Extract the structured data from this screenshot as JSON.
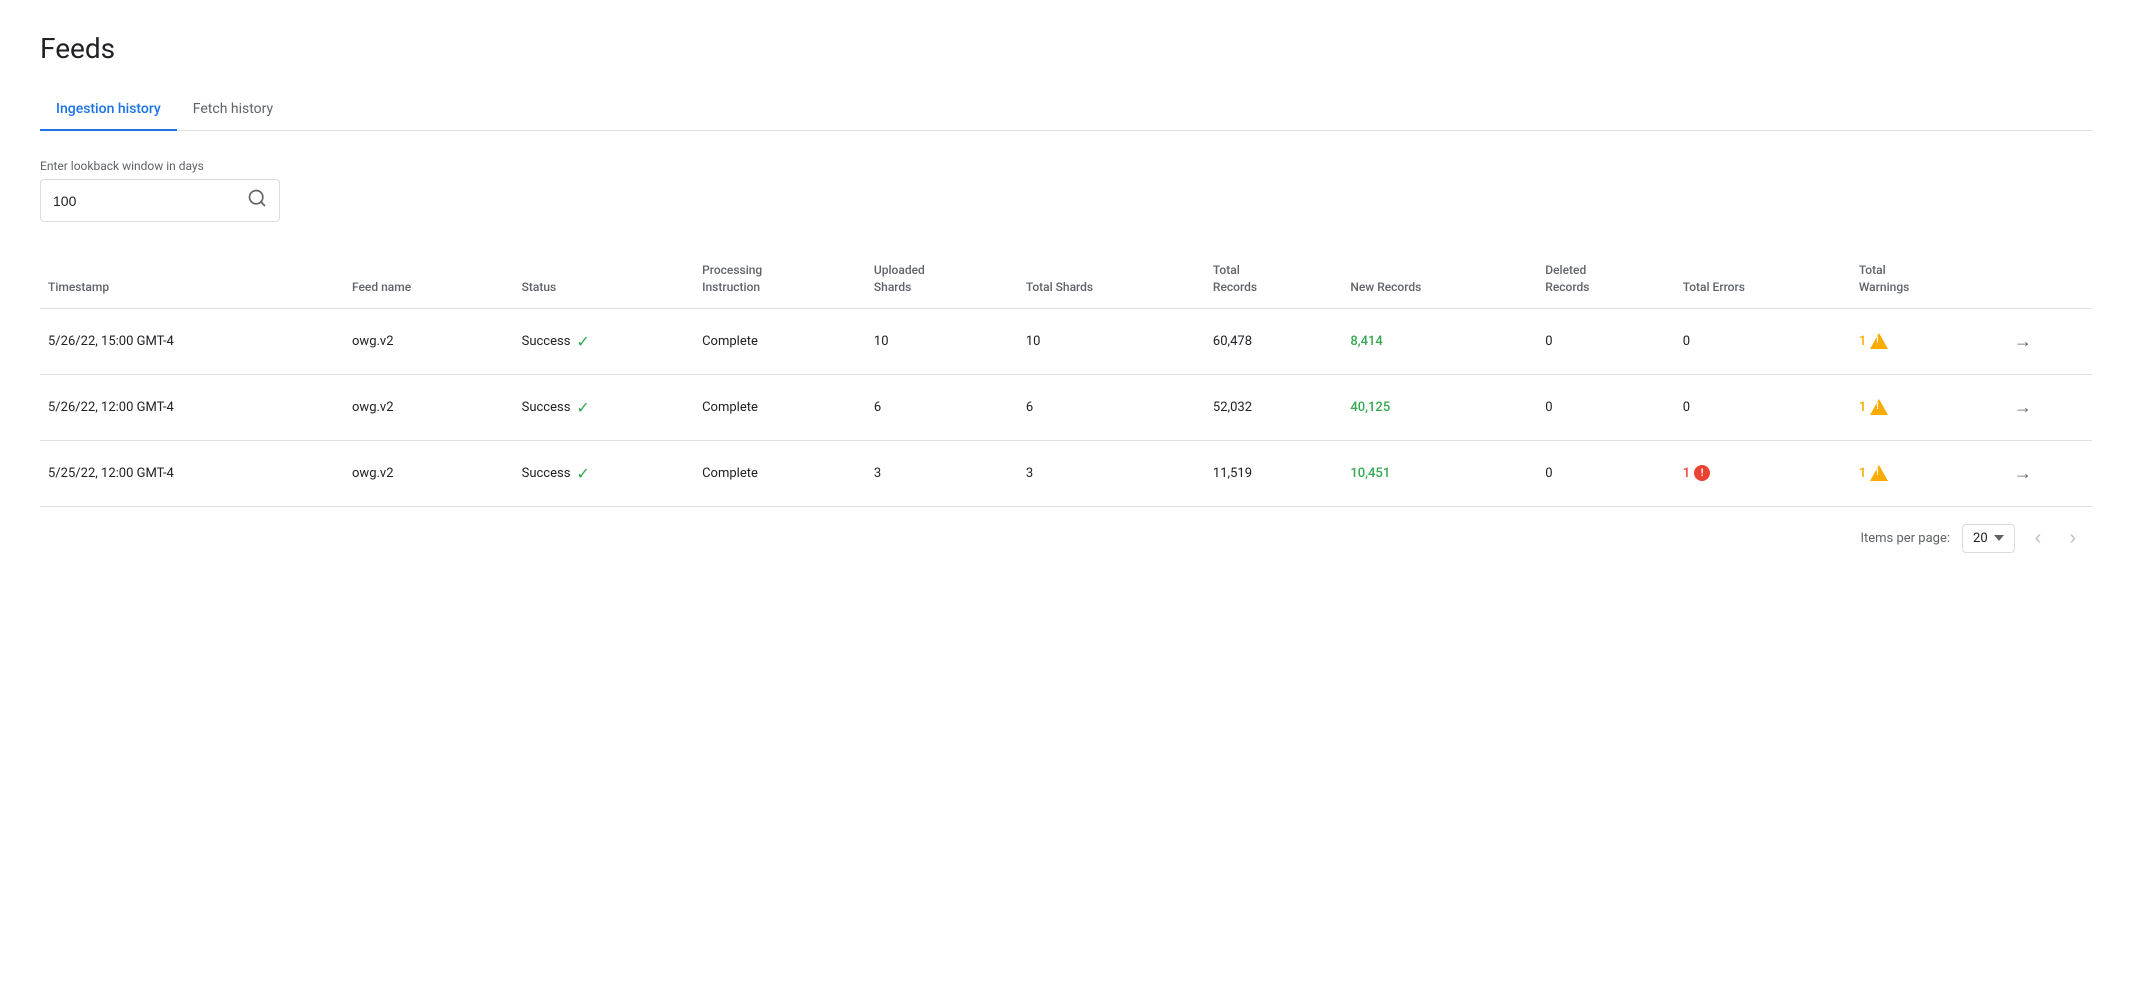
{
  "page": {
    "title": "Feeds"
  },
  "tabs": [
    {
      "id": "ingestion-history",
      "label": "Ingestion history",
      "active": true
    },
    {
      "id": "fetch-history",
      "label": "Fetch history",
      "active": false
    }
  ],
  "search": {
    "label": "Enter lookback window in days",
    "value": "100",
    "placeholder": ""
  },
  "table": {
    "columns": [
      {
        "id": "timestamp",
        "label": "Timestamp"
      },
      {
        "id": "feed-name",
        "label": "Feed name"
      },
      {
        "id": "status",
        "label": "Status"
      },
      {
        "id": "processing-instruction",
        "label": "Processing Instruction"
      },
      {
        "id": "uploaded-shards",
        "label": "Uploaded Shards"
      },
      {
        "id": "total-shards",
        "label": "Total Shards"
      },
      {
        "id": "total-records",
        "label": "Total Records"
      },
      {
        "id": "new-records",
        "label": "New Records"
      },
      {
        "id": "deleted-records",
        "label": "Deleted Records"
      },
      {
        "id": "total-errors",
        "label": "Total Errors"
      },
      {
        "id": "total-warnings",
        "label": "Total Warnings"
      },
      {
        "id": "action",
        "label": ""
      }
    ],
    "rows": [
      {
        "timestamp": "5/26/22, 15:00 GMT-4",
        "feed_name": "owg.v2",
        "status": "Success",
        "processing_instruction": "Complete",
        "uploaded_shards": "10",
        "total_shards": "10",
        "total_records": "60,478",
        "new_records": "8,414",
        "deleted_records": "0",
        "total_errors": "0",
        "total_warnings": "1",
        "has_error": false,
        "has_warning": true
      },
      {
        "timestamp": "5/26/22, 12:00 GMT-4",
        "feed_name": "owg.v2",
        "status": "Success",
        "processing_instruction": "Complete",
        "uploaded_shards": "6",
        "total_shards": "6",
        "total_records": "52,032",
        "new_records": "40,125",
        "deleted_records": "0",
        "total_errors": "0",
        "total_warnings": "1",
        "has_error": false,
        "has_warning": true
      },
      {
        "timestamp": "5/25/22, 12:00 GMT-4",
        "feed_name": "owg.v2",
        "status": "Success",
        "processing_instruction": "Complete",
        "uploaded_shards": "3",
        "total_shards": "3",
        "total_records": "11,519",
        "new_records": "10,451",
        "deleted_records": "0",
        "total_errors": "1",
        "total_warnings": "1",
        "has_error": true,
        "has_warning": true
      }
    ]
  },
  "pagination": {
    "items_per_page_label": "Items per page:",
    "items_per_page_value": "20"
  }
}
